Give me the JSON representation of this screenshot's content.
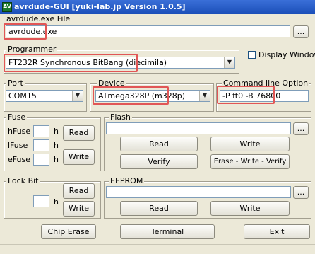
{
  "window": {
    "title": "avrdude-GUI [yuki-lab.jp Version 1.0.5]",
    "icon_text": "AV"
  },
  "avrdude_file": {
    "label": "avrdude.exe File",
    "value": "avrdude.exe",
    "browse_label": "..."
  },
  "programmer": {
    "label": "Programmer",
    "selected": "FT232R Synchronous BitBang (diecimila)"
  },
  "display_window": {
    "label": "Display Window",
    "checked": false
  },
  "port": {
    "label": "Port",
    "selected": "COM15"
  },
  "device": {
    "label": "Device",
    "selected": "ATmega328P (m328p)"
  },
  "command_line": {
    "label": "Command line Option",
    "value": "-P ft0 -B 76800"
  },
  "fuse": {
    "label": "Fuse",
    "hfuse_label": "hFuse",
    "lfuse_label": "lFuse",
    "efuse_label": "eFuse",
    "hex_suffix": "h",
    "read_label": "Read",
    "write_label": "Write"
  },
  "flash": {
    "label": "Flash",
    "browse_label": "...",
    "read_label": "Read",
    "write_label": "Write",
    "verify_label": "Verify",
    "erase_write_verify_label": "Erase - Write - Verify"
  },
  "lock_bit": {
    "label": "Lock Bit",
    "hex_suffix": "h",
    "read_label": "Read",
    "write_label": "Write"
  },
  "eeprom": {
    "label": "EEPROM",
    "browse_label": "...",
    "read_label": "Read",
    "write_label": "Write"
  },
  "bottom": {
    "chip_erase_label": "Chip Erase",
    "terminal_label": "Terminal",
    "exit_label": "Exit"
  },
  "icons": {
    "dropdown": "chevron-down-icon",
    "checkbox": "checkbox-icon"
  }
}
